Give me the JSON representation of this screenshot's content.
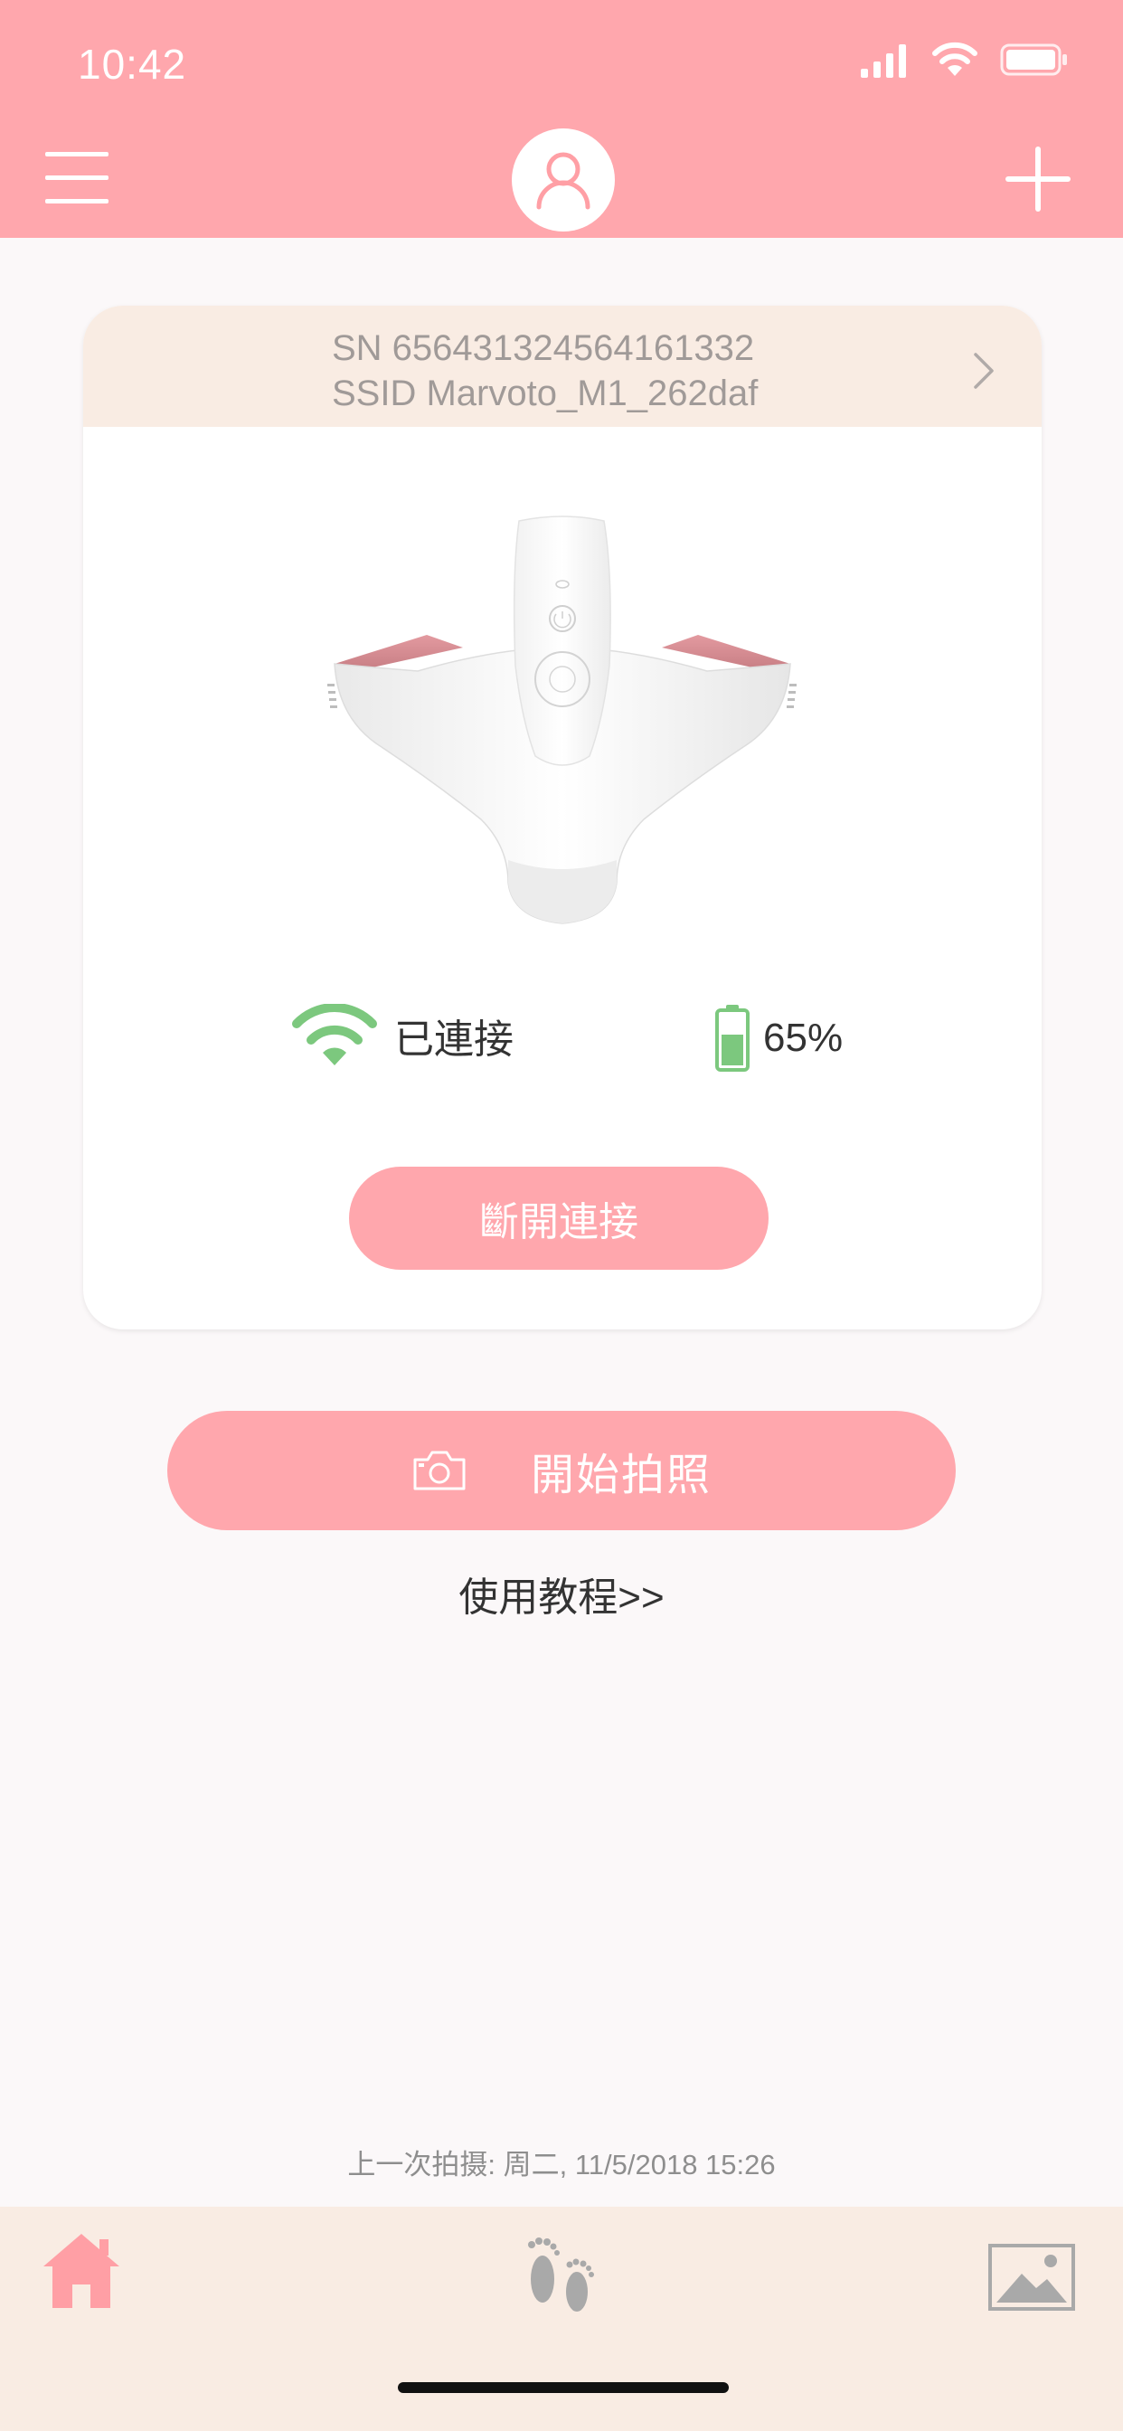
{
  "status_bar": {
    "time": "10:42"
  },
  "device": {
    "sn": "SN 656431324564161332",
    "ssid": "SSID Marvoto_M1_262daf",
    "connection_status": "已連接",
    "battery": "65%",
    "battery_level": 0.65,
    "disconnect_label": "斷開連接"
  },
  "main": {
    "photo_label": "開始拍照",
    "tutorial_label": "使用教程>>",
    "last_capture": "上一次拍摄: 周二, 11/5/2018  15:26"
  },
  "colors": {
    "accent": "#ffa7ad",
    "card_header": "#f9ece3",
    "wifi_green": "#7cc87e",
    "tab_active": "#ff9fa5",
    "tab_inactive": "#a9a9a9"
  },
  "icons": {
    "menu": "menu-icon",
    "avatar": "user-icon",
    "add": "plus-icon",
    "camera": "camera-icon",
    "home": "home-icon",
    "feet": "footprints-icon",
    "gallery": "image-icon"
  }
}
